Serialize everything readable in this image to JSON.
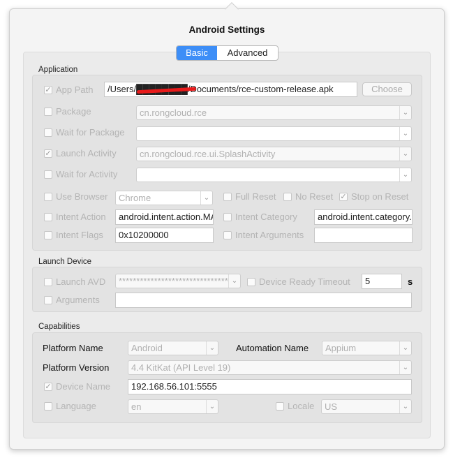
{
  "title": "Android Settings",
  "tabs": [
    {
      "label": "Basic",
      "active": true
    },
    {
      "label": "Advanced",
      "active": false
    }
  ],
  "application": {
    "section_label": "Application",
    "app_path": {
      "label": "App Path",
      "checked": true,
      "value": "/Users/████████/Documents/rce-custom-release.apk",
      "choose_label": "Choose"
    },
    "package": {
      "label": "Package",
      "checked": false,
      "value": "cn.rongcloud.rce"
    },
    "wait_for_package": {
      "label": "Wait for Package",
      "checked": false,
      "value": ""
    },
    "launch_activity": {
      "label": "Launch Activity",
      "checked": true,
      "value": "cn.rongcloud.rce.ui.SplashActivity"
    },
    "wait_for_activity": {
      "label": "Wait for Activity",
      "checked": false,
      "value": ""
    },
    "use_browser": {
      "label": "Use Browser",
      "checked": false,
      "value": "Chrome"
    },
    "full_reset": {
      "label": "Full Reset",
      "checked": false
    },
    "no_reset": {
      "label": "No Reset",
      "checked": false
    },
    "stop_on_reset": {
      "label": "Stop on Reset",
      "checked": true
    },
    "intent_action": {
      "label": "Intent Action",
      "checked": false,
      "value": "android.intent.action.MAIN"
    },
    "intent_category": {
      "label": "Intent Category",
      "checked": false,
      "value": "android.intent.category.LAUNCHER"
    },
    "intent_flags": {
      "label": "Intent Flags",
      "checked": false,
      "value": "0x10200000"
    },
    "intent_arguments": {
      "label": "Intent Arguments",
      "checked": false,
      "value": ""
    }
  },
  "launch_device": {
    "section_label": "Launch Device",
    "launch_avd": {
      "label": "Launch AVD",
      "checked": false,
      "value": "*******************************"
    },
    "device_ready_timeout": {
      "label": "Device Ready Timeout",
      "checked": false,
      "value": "5",
      "unit": "s"
    },
    "arguments": {
      "label": "Arguments",
      "checked": false,
      "value": ""
    }
  },
  "capabilities": {
    "section_label": "Capabilities",
    "platform_name": {
      "label": "Platform Name",
      "value": "Android"
    },
    "automation_name": {
      "label": "Automation Name",
      "value": "Appium"
    },
    "platform_version": {
      "label": "Platform Version",
      "value": "4.4 KitKat (API Level 19)"
    },
    "device_name": {
      "label": "Device Name",
      "checked": true,
      "value": "192.168.56.101:5555"
    },
    "language": {
      "label": "Language",
      "checked": false,
      "value": "en"
    },
    "locale": {
      "label": "Locale",
      "checked": false,
      "value": "US"
    }
  },
  "colors": {
    "accent": "#3d8ef7",
    "redaction": "#e81b1b"
  }
}
